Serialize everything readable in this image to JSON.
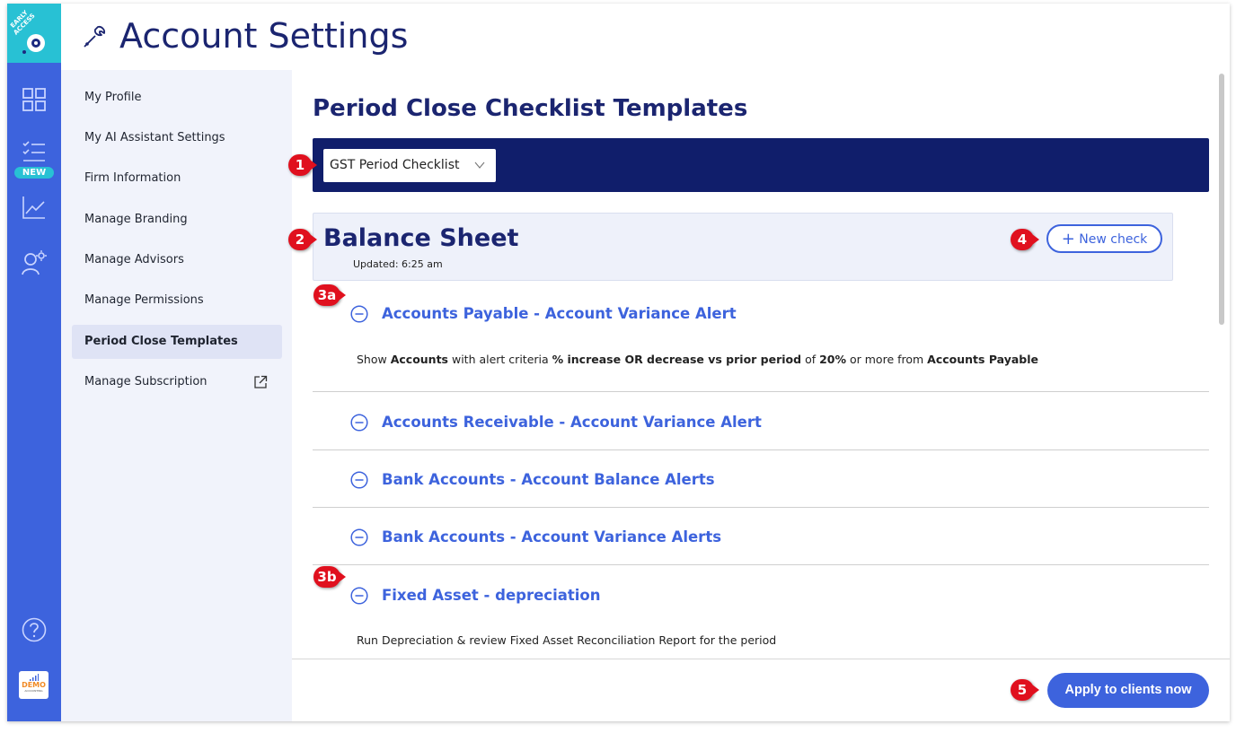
{
  "app": {
    "ribbon_line1": "EARLY",
    "ribbon_line2": "ACCESS",
    "new_badge": "NEW",
    "demo_badge": "DEMO",
    "demo_sub": "ACCOUNTING",
    "accent": "#3d63dd",
    "rail_color": "#3d63dd",
    "navy": "#101e6b",
    "marker_color": "#e0101e"
  },
  "rail": {
    "icons": [
      "dashboard-grid-icon",
      "checklist-icon",
      "chart-trend-icon",
      "user-settings-icon",
      "help-icon"
    ]
  },
  "header": {
    "title": "Account Settings",
    "icon": "wrench-icon"
  },
  "menu": {
    "items": [
      {
        "label": "My Profile"
      },
      {
        "label": "My AI Assistant Settings"
      },
      {
        "label": "Firm Information"
      },
      {
        "label": "Manage Branding"
      },
      {
        "label": "Manage Advisors"
      },
      {
        "label": "Manage Permissions"
      },
      {
        "label": "Period Close Templates",
        "active": true
      },
      {
        "label": "Manage Subscription",
        "icon": "external-link-icon"
      }
    ]
  },
  "main": {
    "section_title": "Period Close Checklist Templates",
    "template_select": {
      "value": "GST Period Checklist"
    },
    "group": {
      "title": "Balance Sheet",
      "updated": "Updated: 6:25 am",
      "new_check_label": "New check"
    },
    "checks": [
      {
        "title": "Accounts Payable - Account Variance Alert",
        "desc": {
          "p1": "Show ",
          "b1": "Accounts",
          "p2": " with alert criteria ",
          "b2": "% increase OR decrease vs prior period",
          "p3": " of ",
          "b3": "20%",
          "p4": " or more from ",
          "b4": "Accounts Payable"
        }
      },
      {
        "title": "Accounts Receivable - Account Variance Alert"
      },
      {
        "title": "Bank Accounts - Account Balance Alerts"
      },
      {
        "title": "Bank Accounts - Account Variance Alerts"
      },
      {
        "title": "Fixed Asset - depreciation",
        "desc_text": "Run Depreciation & review Fixed Asset Reconciliation Report for the period"
      }
    ]
  },
  "footer": {
    "apply_label": "Apply to clients now"
  },
  "markers": [
    "1",
    "2",
    "3a",
    "4",
    "3b",
    "5"
  ]
}
